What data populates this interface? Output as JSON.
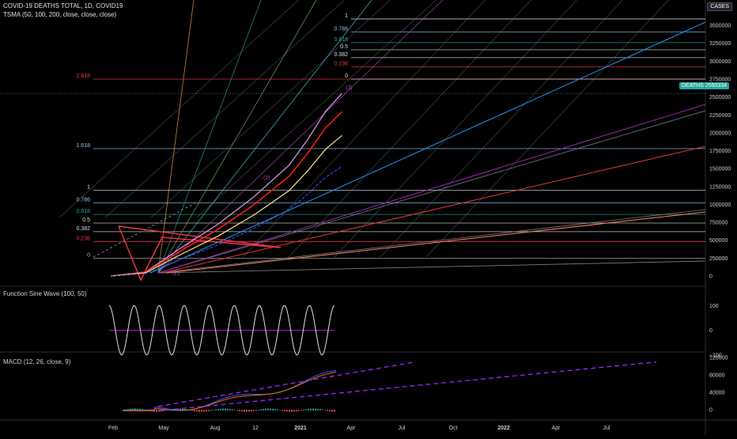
{
  "header": {
    "title": "COVID-19 DEATHS TOTAL, 1D, COVID19",
    "tsma": "TSMA (50, 100, 200, close, close, close)"
  },
  "price_scale": {
    "unit_label": "CASES",
    "last_label": "DEATHS",
    "last_value": "2550334",
    "last_color": "#26a69a"
  },
  "colors": {
    "background": "#000000",
    "grid": "#1e1e1e",
    "fib_line": "#7a7a7a",
    "deaths_line": "#e91e63",
    "ma_red": "#ff1a1a",
    "ma_yellow": "#ffe680",
    "ma_blue": "#3f51ff",
    "macd_dash": "#9c27ff"
  },
  "chart_data": [
    {
      "type": "line",
      "name": "main",
      "x_ticks": [
        "Feb",
        "May",
        "Aug",
        "12",
        "2021",
        "Apr",
        "Jul",
        "Oct",
        "2022",
        "Apr",
        "Jul"
      ],
      "y_ticks": [
        "3500000",
        "3250000",
        "3000000",
        "2750000",
        "2500000",
        "2250000",
        "2000000",
        "1750000",
        "1500000",
        "1250000",
        "1000000",
        "750000",
        "500000",
        "250000",
        "0"
      ],
      "ylim": [
        0,
        3700000
      ],
      "series": [
        {
          "name": "",
          "x": [
            "2020-02-01",
            "2020-04-01",
            "2020-06-01",
            "2020-08-01",
            "2020-10-01",
            "2020-12-01",
            "2021-01-01",
            "2021-02-01",
            "2021-03-01"
          ],
          "values": [
            0,
            60000,
            400000,
            720000,
            1100000,
            1550000,
            1900000,
            2300000,
            2550334
          ]
        }
      ],
      "fib_levels_lower": [
        {
          "label": "0",
          "value": 250000,
          "color": "#b2b5be"
        },
        {
          "label": "0.236",
          "value": 480000,
          "color": "#f23645"
        },
        {
          "label": "0.382",
          "value": 620000,
          "color": "#e0e3eb"
        },
        {
          "label": "0.5",
          "value": 740000,
          "color": "#c8e6c9"
        },
        {
          "label": "0.618",
          "value": 860000,
          "color": "#26a69a"
        },
        {
          "label": "0.786",
          "value": 1020000,
          "color": "#90caf9"
        },
        {
          "label": "1",
          "value": 1200000,
          "color": "#e0e3eb"
        },
        {
          "label": "1.618",
          "value": 1780000,
          "color": "#90caf9"
        },
        {
          "label": "2.618",
          "value": 2750000,
          "color": "#f23645"
        }
      ],
      "fib_levels_upper": [
        {
          "label": "0",
          "value": 2750000,
          "color": "#e0e3eb"
        },
        {
          "label": "0.236",
          "value": 2920000,
          "color": "#f23645"
        },
        {
          "label": "0.382",
          "value": 3050000,
          "color": "#e0e3eb"
        },
        {
          "label": "0.5",
          "value": 3160000,
          "color": "#c8e6c9"
        },
        {
          "label": "0.618",
          "value": 3260000,
          "color": "#26a69a"
        },
        {
          "label": "0.786",
          "value": 3410000,
          "color": "#90caf9"
        },
        {
          "label": "1",
          "value": 3590000,
          "color": "#e0e3eb"
        }
      ],
      "wave_labels": [
        "(2)",
        "(3)",
        "0/1"
      ],
      "grid": false
    },
    {
      "type": "line",
      "name": "Function Sine Wave (100, 50)",
      "y_ticks": [
        "100",
        "0",
        "−100"
      ],
      "ylim": [
        -120,
        120
      ],
      "cycles": 9
    },
    {
      "type": "line",
      "name": "MACD (12, 26, close, 9)",
      "y_ticks": [
        "120000",
        "80000",
        "40000",
        "0"
      ],
      "ylim": [
        -5000,
        125000
      ]
    }
  ]
}
